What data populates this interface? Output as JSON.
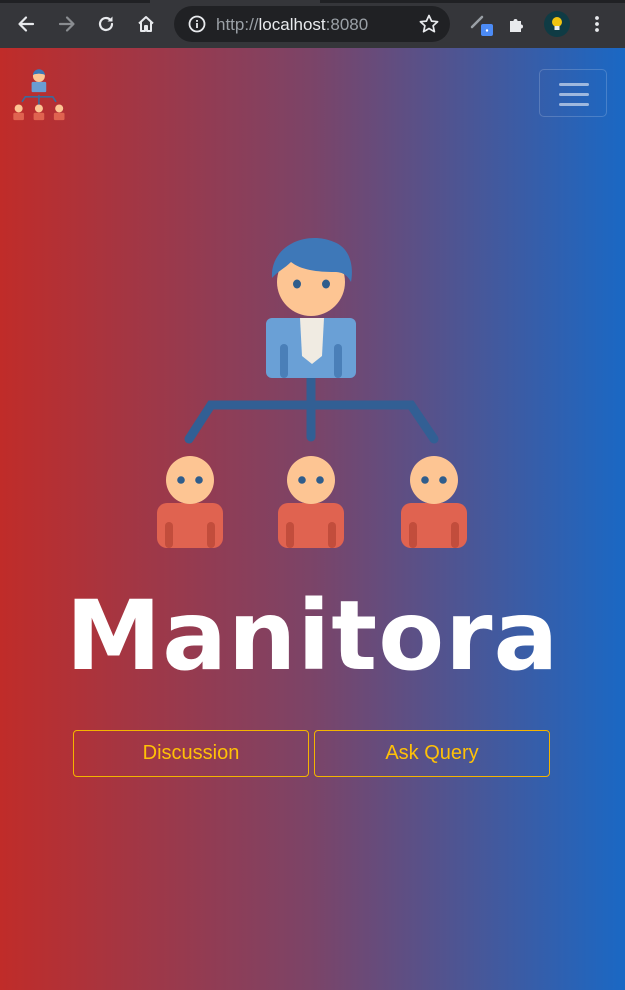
{
  "browser": {
    "url_scheme": "http://",
    "url_host": "localhost",
    "url_port": ":8080"
  },
  "hero": {
    "title": "Manitora",
    "buttons": [
      {
        "label": "Discussion"
      },
      {
        "label": "Ask Query"
      }
    ]
  },
  "colors": {
    "gradient_left": "#c02c29",
    "gradient_mid": "#7b4468",
    "gradient_right": "#1a68c4",
    "button_accent": "#ffc107"
  }
}
